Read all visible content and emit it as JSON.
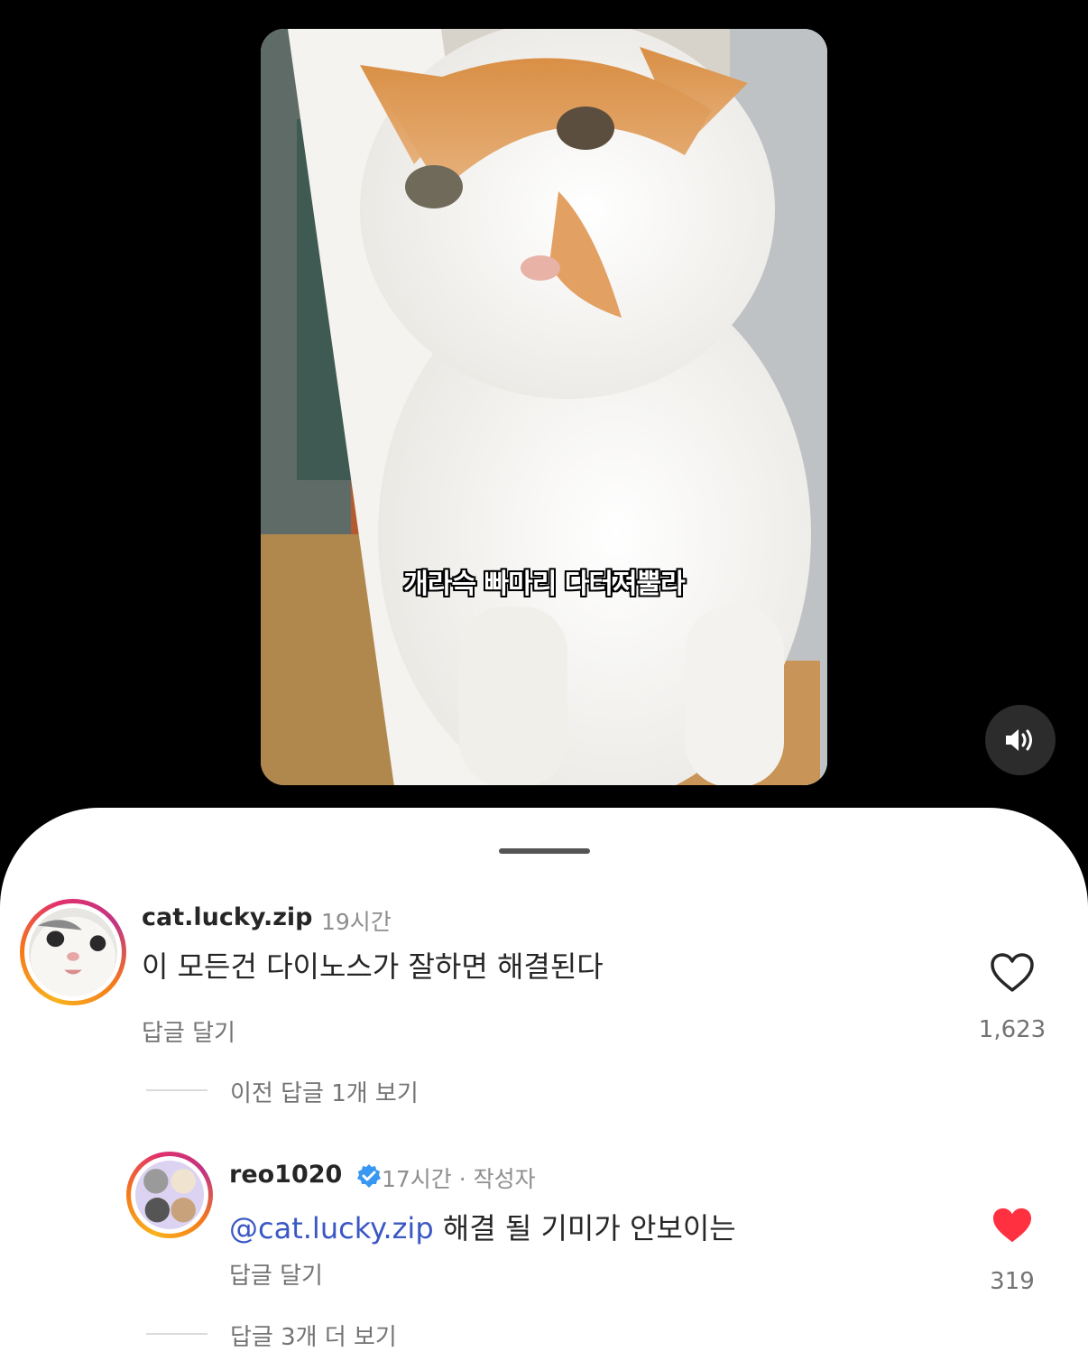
{
  "video": {
    "caption": "개라슥 빠마리 다터져뿔라"
  },
  "comments": [
    {
      "username": "cat.lucky.zip",
      "time": "19시간",
      "text": "이 모든건 다이노스가 잘하면 해결된다",
      "reply_label": "답글 달기",
      "like_count": "1,623",
      "liked": false
    },
    {
      "username": "reo1020",
      "time": "17시간",
      "author_badge": "· 작성자",
      "mention": "@cat.lucky.zip",
      "text": "해결 될 기미가 안보이는",
      "reply_label": "답글 달기",
      "like_count": "319",
      "liked": true,
      "like_color": "#ff3040"
    }
  ],
  "threads": {
    "view_previous": "이전 답글 1개 보기",
    "view_more": "답글 3개 더 보기"
  }
}
